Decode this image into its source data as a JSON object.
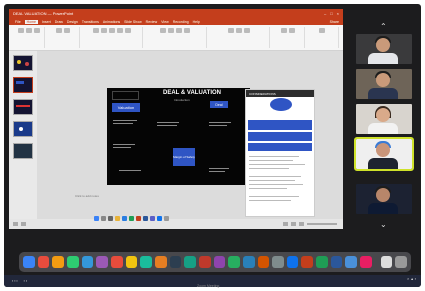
{
  "powerpoint": {
    "window_title": "DEAL VALUATION — PowerPoint",
    "ribbon_tabs": [
      "File",
      "Home",
      "Insert",
      "Draw",
      "Design",
      "Transitions",
      "Animations",
      "Slide Show",
      "Review",
      "View",
      "Recording",
      "Help"
    ],
    "share_label": "Share",
    "notes_placeholder": "Click to add notes"
  },
  "slide": {
    "title": "DEAL & VALUATION",
    "subtitle": "Introduction",
    "valuation_label": "Valuation",
    "deal_label": "Deal",
    "margin_label": "Margin of Safety"
  },
  "doc_panel": {
    "header": "CONSIDERATIONS"
  },
  "colors": {
    "ppt_accent": "#c43e1c",
    "slide_blue": "#2f55c4",
    "active_speaker": "#cfe22a"
  },
  "participants": [
    {
      "icon": "person-in-suit-icon"
    },
    {
      "icon": "person-in-suit-icon"
    },
    {
      "icon": "person-icon"
    },
    {
      "icon": "person-with-turban-icon"
    },
    {
      "icon": "person-in-suit-icon"
    }
  ],
  "bottom_label": "Zoom Meeting"
}
